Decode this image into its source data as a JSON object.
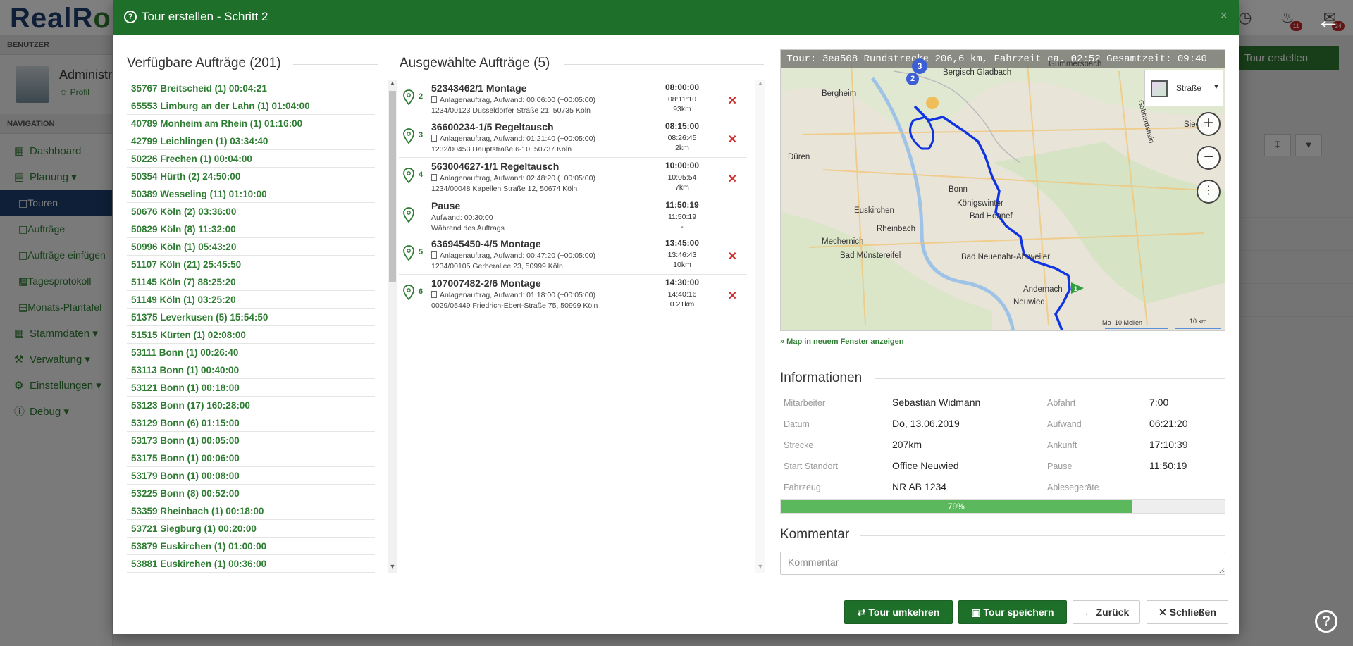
{
  "app": {
    "logo_main": "RealR",
    "logo_tail": "o",
    "notifications_count": "11",
    "messages_count": "24"
  },
  "sidebar": {
    "user_section": "BENUTZER",
    "admin_name": "Administr",
    "profile_link": "Profil",
    "nav_section": "NAVIGATION",
    "items": [
      {
        "label": "Dashboard"
      },
      {
        "label": "Planung"
      },
      {
        "label": "Touren"
      },
      {
        "label": "Aufträge"
      },
      {
        "label": "Aufträge einfügen"
      },
      {
        "label": "Tagesprotokoll"
      },
      {
        "label": "Monats-Plantafel"
      },
      {
        "label": "Stammdaten"
      },
      {
        "label": "Verwaltung"
      },
      {
        "label": "Einstellungen"
      },
      {
        "label": "Debug"
      }
    ]
  },
  "background": {
    "create_tour_button": "Tour erstellen"
  },
  "modal": {
    "title": "Tour erstellen - Schritt 2",
    "close_label": "×",
    "available": {
      "title": "Verfügbare Aufträge (201)",
      "items": [
        "35767 Breitscheid (1) 00:04:21",
        "65553 Limburg an der Lahn (1) 01:04:00",
        "40789 Monheim am Rhein (1) 01:16:00",
        "42799 Leichlingen (1) 03:34:40",
        "50226 Frechen (1) 00:04:00",
        "50354 Hürth (2) 24:50:00",
        "50389 Wesseling (11) 01:10:00",
        "50676 Köln (2) 03:36:00",
        "50829 Köln (8) 11:32:00",
        "50996 Köln (1) 05:43:20",
        "51107 Köln (21) 25:45:50",
        "51145 Köln (7) 88:25:20",
        "51149 Köln (1) 03:25:20",
        "51375 Leverkusen (5) 15:54:50",
        "51515 Kürten (1) 02:08:00",
        "53111 Bonn (1) 00:26:40",
        "53113 Bonn (1) 00:40:00",
        "53121 Bonn (1) 00:18:00",
        "53123 Bonn (17) 160:28:00",
        "53129 Bonn (6) 01:15:00",
        "53173 Bonn (1) 00:05:00",
        "53175 Bonn (1) 00:06:00",
        "53179 Bonn (1) 00:08:00",
        "53225 Bonn (8) 00:52:00",
        "53359 Rheinbach (1) 00:18:00",
        "53721 Siegburg (1) 00:20:00",
        "53879 Euskirchen (1) 01:00:00",
        "53881 Euskirchen (1) 00:36:00"
      ]
    },
    "selected": {
      "title": "Ausgewählte Aufträge (5)",
      "items": [
        {
          "seq": "2",
          "title": "52343462/1 Montage",
          "line1": "Anlagenauftrag, Aufwand: 00:06:00 (+00:05:00)",
          "line2": "1234/00123 Düsseldorfer Straße 21, 50735 Köln",
          "time": "08:00:00",
          "sub1": "08:11:10",
          "sub2": "93km",
          "deletable": true
        },
        {
          "seq": "3",
          "title": "36600234-1/5 Regeltausch",
          "line1": "Anlagenauftrag, Aufwand: 01:21:40 (+00:05:00)",
          "line2": "1232/00453 Hauptstraße 6-10, 50737 Köln",
          "time": "08:15:00",
          "sub1": "08:26:45",
          "sub2": "2km",
          "deletable": true
        },
        {
          "seq": "4",
          "title": "563004627-1/1 Regeltausch",
          "line1": "Anlagenauftrag, Aufwand: 02:48:20 (+00:05:00)",
          "line2": "1234/00048 Kapellen Straße 12, 50674 Köln",
          "time": "10:00:00",
          "sub1": "10:05:54",
          "sub2": "7km",
          "deletable": true
        },
        {
          "seq": "",
          "title": "Pause",
          "line1": "Aufwand: 00:30:00",
          "line2": "Während des Auftrags",
          "time": "11:50:19",
          "sub1": "11:50:19",
          "sub2": "-",
          "deletable": false
        },
        {
          "seq": "5",
          "title": "636945450-4/5 Montage",
          "line1": "Anlagenauftrag, Aufwand: 00:47:20 (+00:05:00)",
          "line2": "1234/00105 Gerberallee 23, 50999 Köln",
          "time": "13:45:00",
          "sub1": "13:46:43",
          "sub2": "10km",
          "deletable": true
        },
        {
          "seq": "6",
          "title": "107007482-2/6 Montage",
          "line1": "Anlagenauftrag, Aufwand: 01:18:00 (+00:05:00)",
          "line2": "0029/05449 Friedrich-Ebert-Straße 75, 50999 Köln",
          "time": "14:30:00",
          "sub1": "14:40:16",
          "sub2": "0.21km",
          "deletable": true
        }
      ]
    },
    "map": {
      "header": "Tour: 3ea508    Rundstrecke 206,6 km, Fahrzeit ca. 02:52 Gesamtzeit: 09:40",
      "layer": "Straße",
      "labels": [
        "Bergisch Gladbach",
        "Gummersbach",
        "Bergheim",
        "Düren",
        "Bonn",
        "Königswinter",
        "Bad Honnef",
        "Euskirchen",
        "Rheinbach",
        "Mechernich",
        "Bad Münstereifel",
        "Bad Neuenahr-Ahrweiler",
        "Andernach",
        "Neuwied",
        "Siegen",
        "Gebhardshain"
      ],
      "scale_left": "10 Meilen",
      "scale_right": "10 km",
      "credit": "Mo",
      "open_link": "» Map in neuem Fenster anzeigen",
      "marker_labels": [
        "3",
        "2",
        "1"
      ]
    },
    "info": {
      "title": "Informationen",
      "left": [
        {
          "key": "Mitarbeiter",
          "value": "Sebastian Widmann"
        },
        {
          "key": "Datum",
          "value": "Do, 13.06.2019"
        },
        {
          "key": "Strecke",
          "value": "207km"
        },
        {
          "key": "Start Standort",
          "value": "Office Neuwied"
        },
        {
          "key": "Fahrzeug",
          "value": "NR AB 1234"
        }
      ],
      "right": [
        {
          "key": "Abfahrt",
          "value": "7:00"
        },
        {
          "key": "Aufwand",
          "value": "06:21:20"
        },
        {
          "key": "Ankunft",
          "value": "17:10:39"
        },
        {
          "key": "Pause",
          "value": "11:50:19"
        },
        {
          "key": "Ablesegeräte",
          "value": ""
        }
      ],
      "progress_percent": 79,
      "progress_label": "79%"
    },
    "comment": {
      "title": "Kommentar",
      "placeholder": "Kommentar"
    },
    "footer": {
      "reverse": "Tour umkehren",
      "save": "Tour speichern",
      "back": "Zurück",
      "close": "Schließen"
    }
  }
}
